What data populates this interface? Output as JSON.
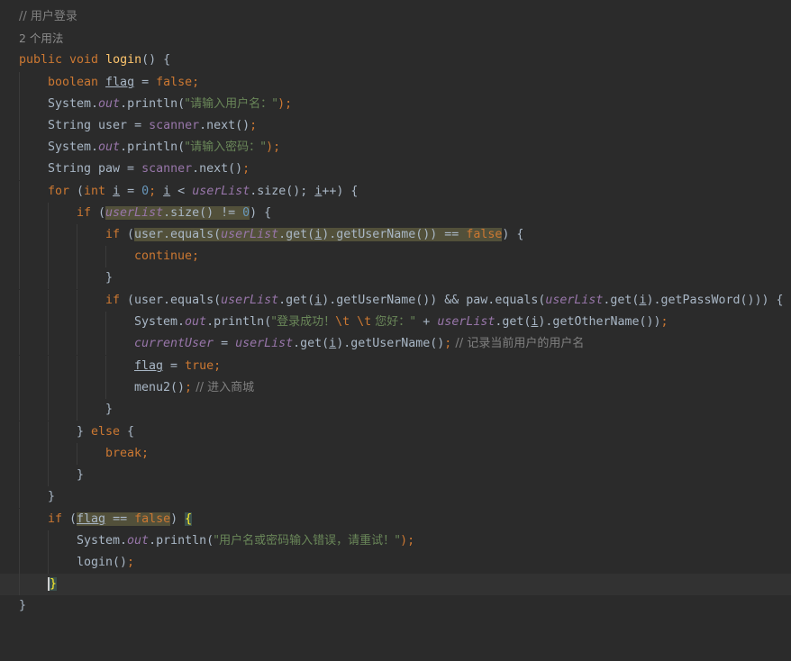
{
  "editor": {
    "comment_header": "// 用户登录",
    "usage_hint": "2 个用法",
    "method_signature": {
      "mods": "public void ",
      "name": "login",
      "rest": "() {"
    },
    "lines": {
      "l3": {
        "kw": "boolean ",
        "var": "flag",
        "rest": " = ",
        "val": "false",
        "end": ";"
      },
      "l4": {
        "pre": "System.",
        "field": "out",
        "mid": ".println(",
        "str": "\"请输入用户名：\"",
        "end": ");"
      },
      "l5": {
        "pre": "String user = ",
        "field": "scanner",
        "mid": ".next()",
        "end": ";"
      },
      "l6": {
        "pre": "System.",
        "field": "out",
        "mid": ".println(",
        "str": "\"请输入密码：\"",
        "end": ");"
      },
      "l7": {
        "pre": "String paw = ",
        "field": "scanner",
        "mid": ".next()",
        "end": ";"
      },
      "l8": {
        "kw": "for",
        "a": " (",
        "kw2": "int ",
        "i1": "i",
        "b": " = ",
        "n0": "0",
        "c": "; ",
        "i2": "i",
        "d": " < ",
        "list": "userList",
        "e": ".size(); ",
        "i3": "i",
        "f": "++) {"
      },
      "l9": {
        "kw": "if",
        "a": " (",
        "list": "userList",
        "b": ".size() != ",
        "n0": "0",
        "c": ") {"
      },
      "l10": {
        "kw": "if",
        "a": " (",
        "b": "user.equals(",
        "list": "userList",
        "c": ".get(",
        "i": "i",
        "d": ").getUserName()) == ",
        "val": "false",
        "e": ") {"
      },
      "l11": {
        "kw": "continue",
        "end": ";"
      },
      "l12": {
        "text": "}"
      },
      "l13": {
        "kw": "if",
        "a": " (user.equals(",
        "list": "userList",
        "b": ".get(",
        "i": "i",
        "c": ").getUserName()) && paw.equals(",
        "list2": "userList",
        "d": ".get(",
        "i2": "i",
        "e": ").getPassWord())) {"
      },
      "l14": {
        "pre": "System.",
        "field": "out",
        "mid": ".println(",
        "str1": "\"登录成功！",
        "esc1": "\\t",
        "sp": " ",
        "esc2": "\\t",
        "str2": " 您好：\"",
        "plus": " + ",
        "list": "userList",
        "a": ".get(",
        "i": "i",
        "b": ").getOtherName())",
        "end": ";"
      },
      "l15": {
        "cur": "currentUser",
        "a": " = ",
        "list": "userList",
        "b": ".get(",
        "i": "i",
        "c": ").getUserName()",
        "semi": ";",
        "comment": " // 记录当前用户的用户名"
      },
      "l16": {
        "var": "flag",
        "a": " = ",
        "val": "true",
        "end": ";"
      },
      "l17": {
        "a": "menu2()",
        "semi": ";",
        "comment": " // 进入商城"
      },
      "l18": {
        "text": "}"
      },
      "l19": {
        "a": "} ",
        "kw": "else",
        "b": " {"
      },
      "l20": {
        "kw": "break",
        "end": ";"
      },
      "l21": {
        "text": "}"
      },
      "l22": {
        "text": "}"
      },
      "l23": {
        "kw": "if",
        "a": " (",
        "var": "flag",
        "b": " == ",
        "val": "false",
        "c": ") ",
        "brace": "{"
      },
      "l24": {
        "pre": "System.",
        "field": "out",
        "mid": ".println(",
        "str": "\"用户名或密码输入错误，请重试！\"",
        "end": ");"
      },
      "l25": {
        "a": "login()",
        "end": ";"
      },
      "l26": {
        "brace": "}"
      },
      "l27": {
        "text": "}"
      }
    }
  }
}
